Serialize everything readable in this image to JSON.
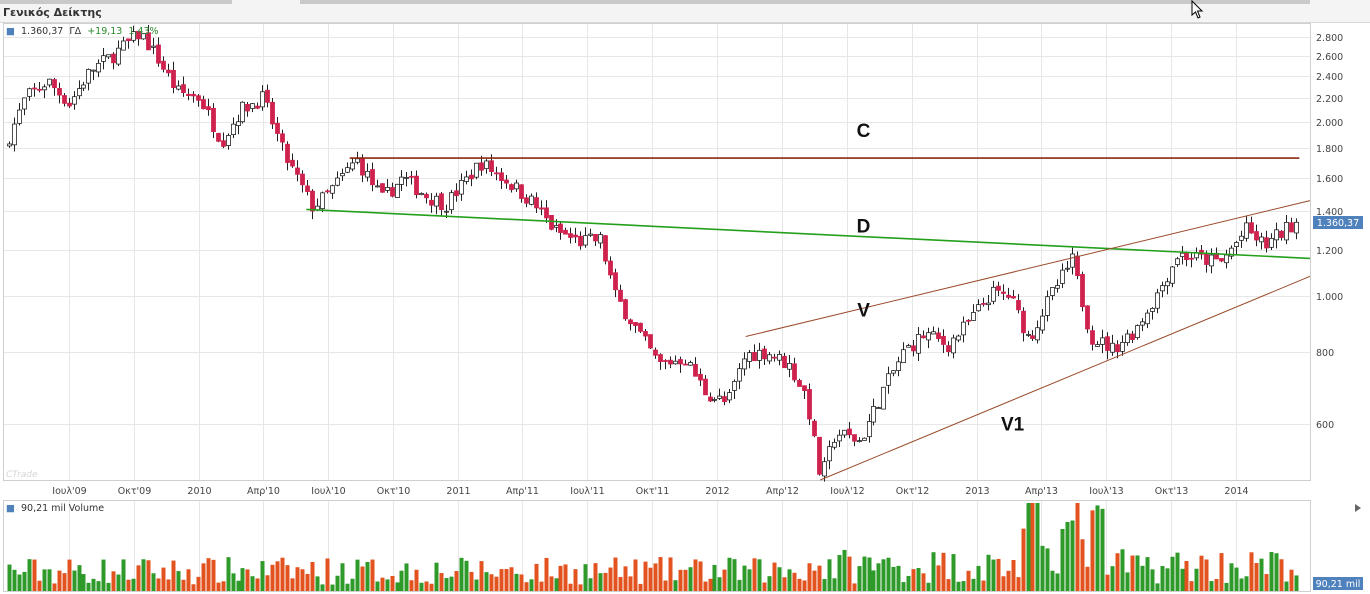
{
  "window": {
    "title": "Γενικός Δείκτης"
  },
  "price_panel": {
    "legend_value": "1.360,37",
    "legend_label": "ΓΔ",
    "legend_change": "+19,13",
    "legend_pct": "1,43%",
    "last_price_tag": "1.360,37",
    "watermark": "CTrade"
  },
  "volume_panel": {
    "legend": "90,21 mil Volume",
    "last_volume_tag": "90,21 mil"
  },
  "colors": {
    "up": "#ffffff",
    "down": "#d0224e",
    "candle_outline": "#222222",
    "line_C": "#8b2a10",
    "line_D": "#25a01c",
    "channel": "#9a4a2a",
    "vol_up": "#2e9a2a",
    "vol_down": "#e2531f",
    "price_tag": "#4f81bd"
  },
  "chart_data": [
    {
      "type": "candlestick",
      "title": "Γενικός Δείκτης",
      "y_scale": "log",
      "y_ticks": [
        600,
        800,
        1000,
        1200,
        1400,
        1600,
        1800,
        2000,
        2200,
        2400,
        2600,
        2800
      ],
      "y_tick_labels": [
        "600",
        "800",
        "1.000",
        "1.200",
        "1.400",
        "1.600",
        "1.800",
        "2.000",
        "2.200",
        "2.400",
        "2.600",
        "2.800"
      ],
      "ylim": [
        480,
        2950
      ],
      "x_tick_labels": [
        {
          "date": "2009-07",
          "label": "Ιουλ'09"
        },
        {
          "date": "2009-10",
          "label": "Οκτ'09"
        },
        {
          "date": "2010-01",
          "label": "2010"
        },
        {
          "date": "2010-04",
          "label": "Απρ'10"
        },
        {
          "date": "2010-07",
          "label": "Ιουλ'10"
        },
        {
          "date": "2010-10",
          "label": "Οκτ'10"
        },
        {
          "date": "2011-01",
          "label": "2011"
        },
        {
          "date": "2011-04",
          "label": "Απρ'11"
        },
        {
          "date": "2011-07",
          "label": "Ιουλ'11"
        },
        {
          "date": "2011-10",
          "label": "Οκτ'11"
        },
        {
          "date": "2012-01",
          "label": "2012"
        },
        {
          "date": "2012-04",
          "label": "Απρ'12"
        },
        {
          "date": "2012-07",
          "label": "Ιουλ'12"
        },
        {
          "date": "2012-10",
          "label": "Οκτ'12"
        },
        {
          "date": "2013-01",
          "label": "2013"
        },
        {
          "date": "2013-04",
          "label": "Απρ'13"
        },
        {
          "date": "2013-07",
          "label": "Ιουλ'13"
        },
        {
          "date": "2013-10",
          "label": "Οκτ'13"
        },
        {
          "date": "2014-01",
          "label": "2014"
        }
      ],
      "xlim": [
        "2009-04-01",
        "2014-04-15"
      ],
      "close_series": [
        [
          "2009-04-01",
          1800
        ],
        [
          "2009-05-01",
          2200
        ],
        [
          "2009-06-01",
          2350
        ],
        [
          "2009-07-01",
          2150
        ],
        [
          "2009-08-01",
          2450
        ],
        [
          "2009-09-01",
          2600
        ],
        [
          "2009-10-10",
          2850
        ],
        [
          "2009-11-01",
          2600
        ],
        [
          "2009-12-01",
          2250
        ],
        [
          "2010-01-01",
          2200
        ],
        [
          "2010-02-01",
          1850
        ],
        [
          "2010-03-01",
          2100
        ],
        [
          "2010-04-01",
          2200
        ],
        [
          "2010-05-01",
          1750
        ],
        [
          "2010-06-10",
          1420
        ],
        [
          "2010-07-01",
          1500
        ],
        [
          "2010-08-10",
          1720
        ],
        [
          "2010-09-15",
          1470
        ],
        [
          "2010-10-15",
          1600
        ],
        [
          "2010-11-20",
          1480
        ],
        [
          "2010-12-15",
          1440
        ],
        [
          "2011-02-01",
          1700
        ],
        [
          "2011-03-10",
          1580
        ],
        [
          "2011-04-15",
          1450
        ],
        [
          "2011-05-15",
          1300
        ],
        [
          "2011-06-20",
          1240
        ],
        [
          "2011-07-20",
          1250
        ],
        [
          "2011-08-10",
          1000
        ],
        [
          "2011-09-15",
          850
        ],
        [
          "2011-10-10",
          760
        ],
        [
          "2011-11-15",
          780
        ],
        [
          "2011-12-15",
          680
        ],
        [
          "2012-01-15",
          650
        ],
        [
          "2012-02-10",
          790
        ],
        [
          "2012-03-10",
          800
        ],
        [
          "2012-04-10",
          760
        ],
        [
          "2012-05-05",
          670
        ],
        [
          "2012-05-25",
          480
        ],
        [
          "2012-06-15",
          580
        ],
        [
          "2012-07-20",
          560
        ],
        [
          "2012-08-20",
          680
        ],
        [
          "2012-09-20",
          800
        ],
        [
          "2012-10-20",
          860
        ],
        [
          "2012-11-20",
          820
        ],
        [
          "2012-12-20",
          900
        ],
        [
          "2013-01-20",
          1010
        ],
        [
          "2013-02-15",
          1000
        ],
        [
          "2013-03-15",
          840
        ],
        [
          "2013-04-15",
          1000
        ],
        [
          "2013-05-15",
          1150
        ],
        [
          "2013-06-10",
          850
        ],
        [
          "2013-07-10",
          810
        ],
        [
          "2013-08-10",
          870
        ],
        [
          "2013-09-10,",
          1000
        ],
        [
          "2013-10-10",
          1180
        ],
        [
          "2013-11-10",
          1160
        ],
        [
          "2013-12-10",
          1140
        ],
        [
          "2014-01-15",
          1300
        ],
        [
          "2014-02-10",
          1220
        ],
        [
          "2014-03-10",
          1300
        ],
        [
          "2014-03-31",
          1360
        ]
      ],
      "annotations": [
        {
          "label": "C",
          "kind": "horizontal",
          "points": [
            [
              "2010-08-01",
              1730
            ],
            [
              "2014-03-31",
              1730
            ]
          ]
        },
        {
          "label": "D",
          "kind": "trendline",
          "points": [
            [
              "2010-06-01",
              1410
            ],
            [
              "2014-04-15",
              1160
            ]
          ]
        },
        {
          "label": "V",
          "kind": "trendline",
          "points": [
            [
              "2012-02-10",
              850
            ],
            [
              "2014-04-15",
              1460
            ]
          ]
        },
        {
          "label": "V1",
          "kind": "trendline",
          "points": [
            [
              "2012-05-25",
              480
            ],
            [
              "2014-04-15",
              1080
            ]
          ]
        }
      ]
    },
    {
      "type": "bar",
      "title": "Volume",
      "series": [
        {
          "name": "Volume",
          "units": "mil"
        }
      ]
    }
  ]
}
